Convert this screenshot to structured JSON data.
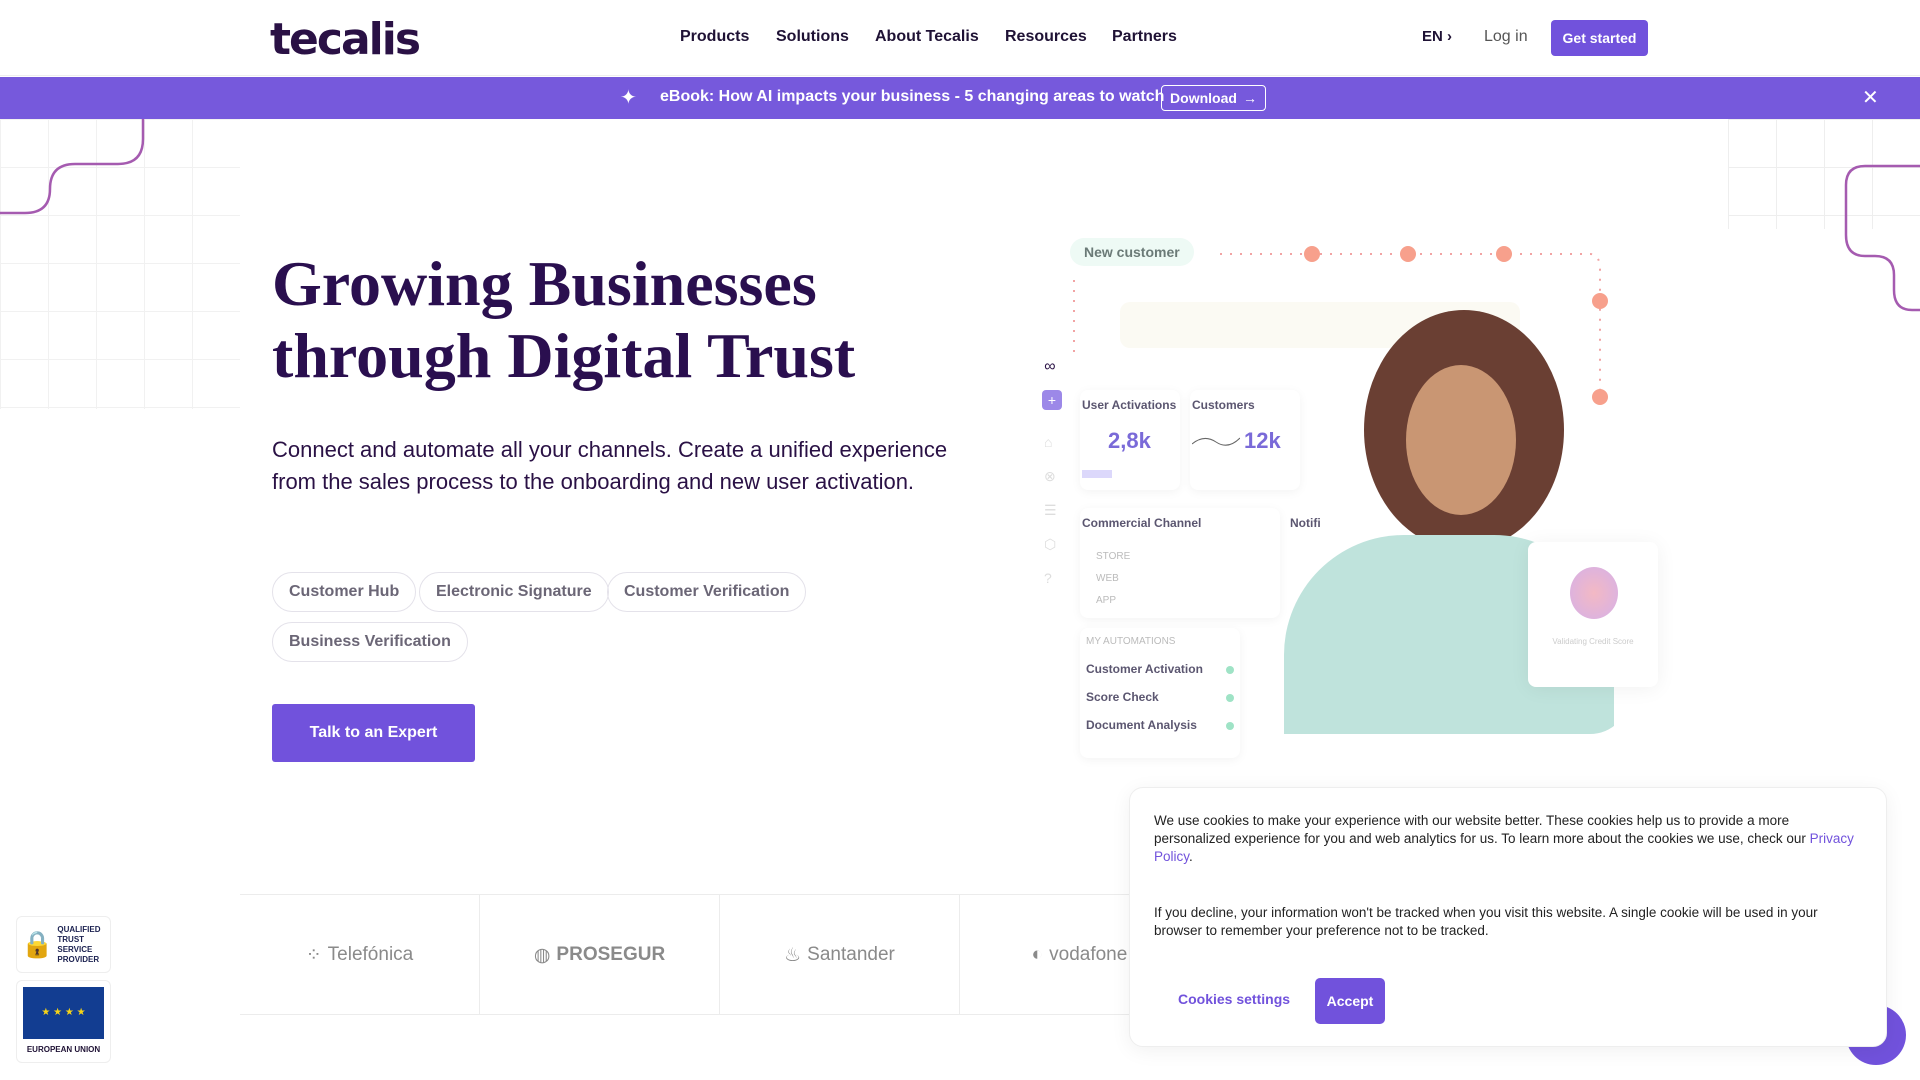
{
  "header": {
    "logo": "tecalis",
    "nav": [
      "Products",
      "Solutions",
      "About Tecalis",
      "Resources",
      "Partners"
    ],
    "language": "EN",
    "login": "Log in",
    "get_started": "Get started"
  },
  "banner": {
    "text": "eBook: How AI impacts your business - 5 changing areas to watch",
    "download": "Download"
  },
  "hero": {
    "title_line1": "Growing Businesses",
    "title_line2": "through Digital Trust",
    "lead": "Connect and automate all your channels. Create a unified experience from the sales process to the onboarding and new user activation.",
    "chips": [
      "Customer Hub",
      "Electronic Signature",
      "Customer Verification",
      "Business Verification"
    ],
    "cta": "Talk to an Expert"
  },
  "illustration": {
    "new_customer": "New customer",
    "user_activations": "User Activations",
    "user_activations_value": "2,8k",
    "customers": "Customers",
    "customers_value": "12k",
    "commercial_channel": "Commercial Channel",
    "notifications": "Notifi",
    "channels": [
      "STORE",
      "WEB",
      "APP"
    ],
    "automations_title": "MY AUTOMATIONS",
    "automations": [
      "Customer Activation",
      "Score Check",
      "Document Analysis"
    ],
    "validating": "Validating Credit Score"
  },
  "logos": [
    "Telefónica",
    "PROSEGUR",
    "Santander",
    "vodafone"
  ],
  "badges": {
    "trust": "QUALIFIED TRUST SERVICE PROVIDER",
    "eu": "EUROPEAN UNION"
  },
  "cookie": {
    "text1": "We use cookies to make your experience with our website better. These cookies help us to provide a more personalized experience for you and web analytics for us. To learn more about the cookies we use, check our ",
    "privacy_link": "Privacy Policy",
    "text2": "If you decline, your information won't be tracked when you visit this website. A single cookie will be used in your browser to remember your preference not to be tracked.",
    "settings": "Cookies settings",
    "accept": "Accept"
  },
  "colors": {
    "brand": "#7152dc",
    "title": "#2a0f4f",
    "accent_dots": "#f59a86"
  }
}
